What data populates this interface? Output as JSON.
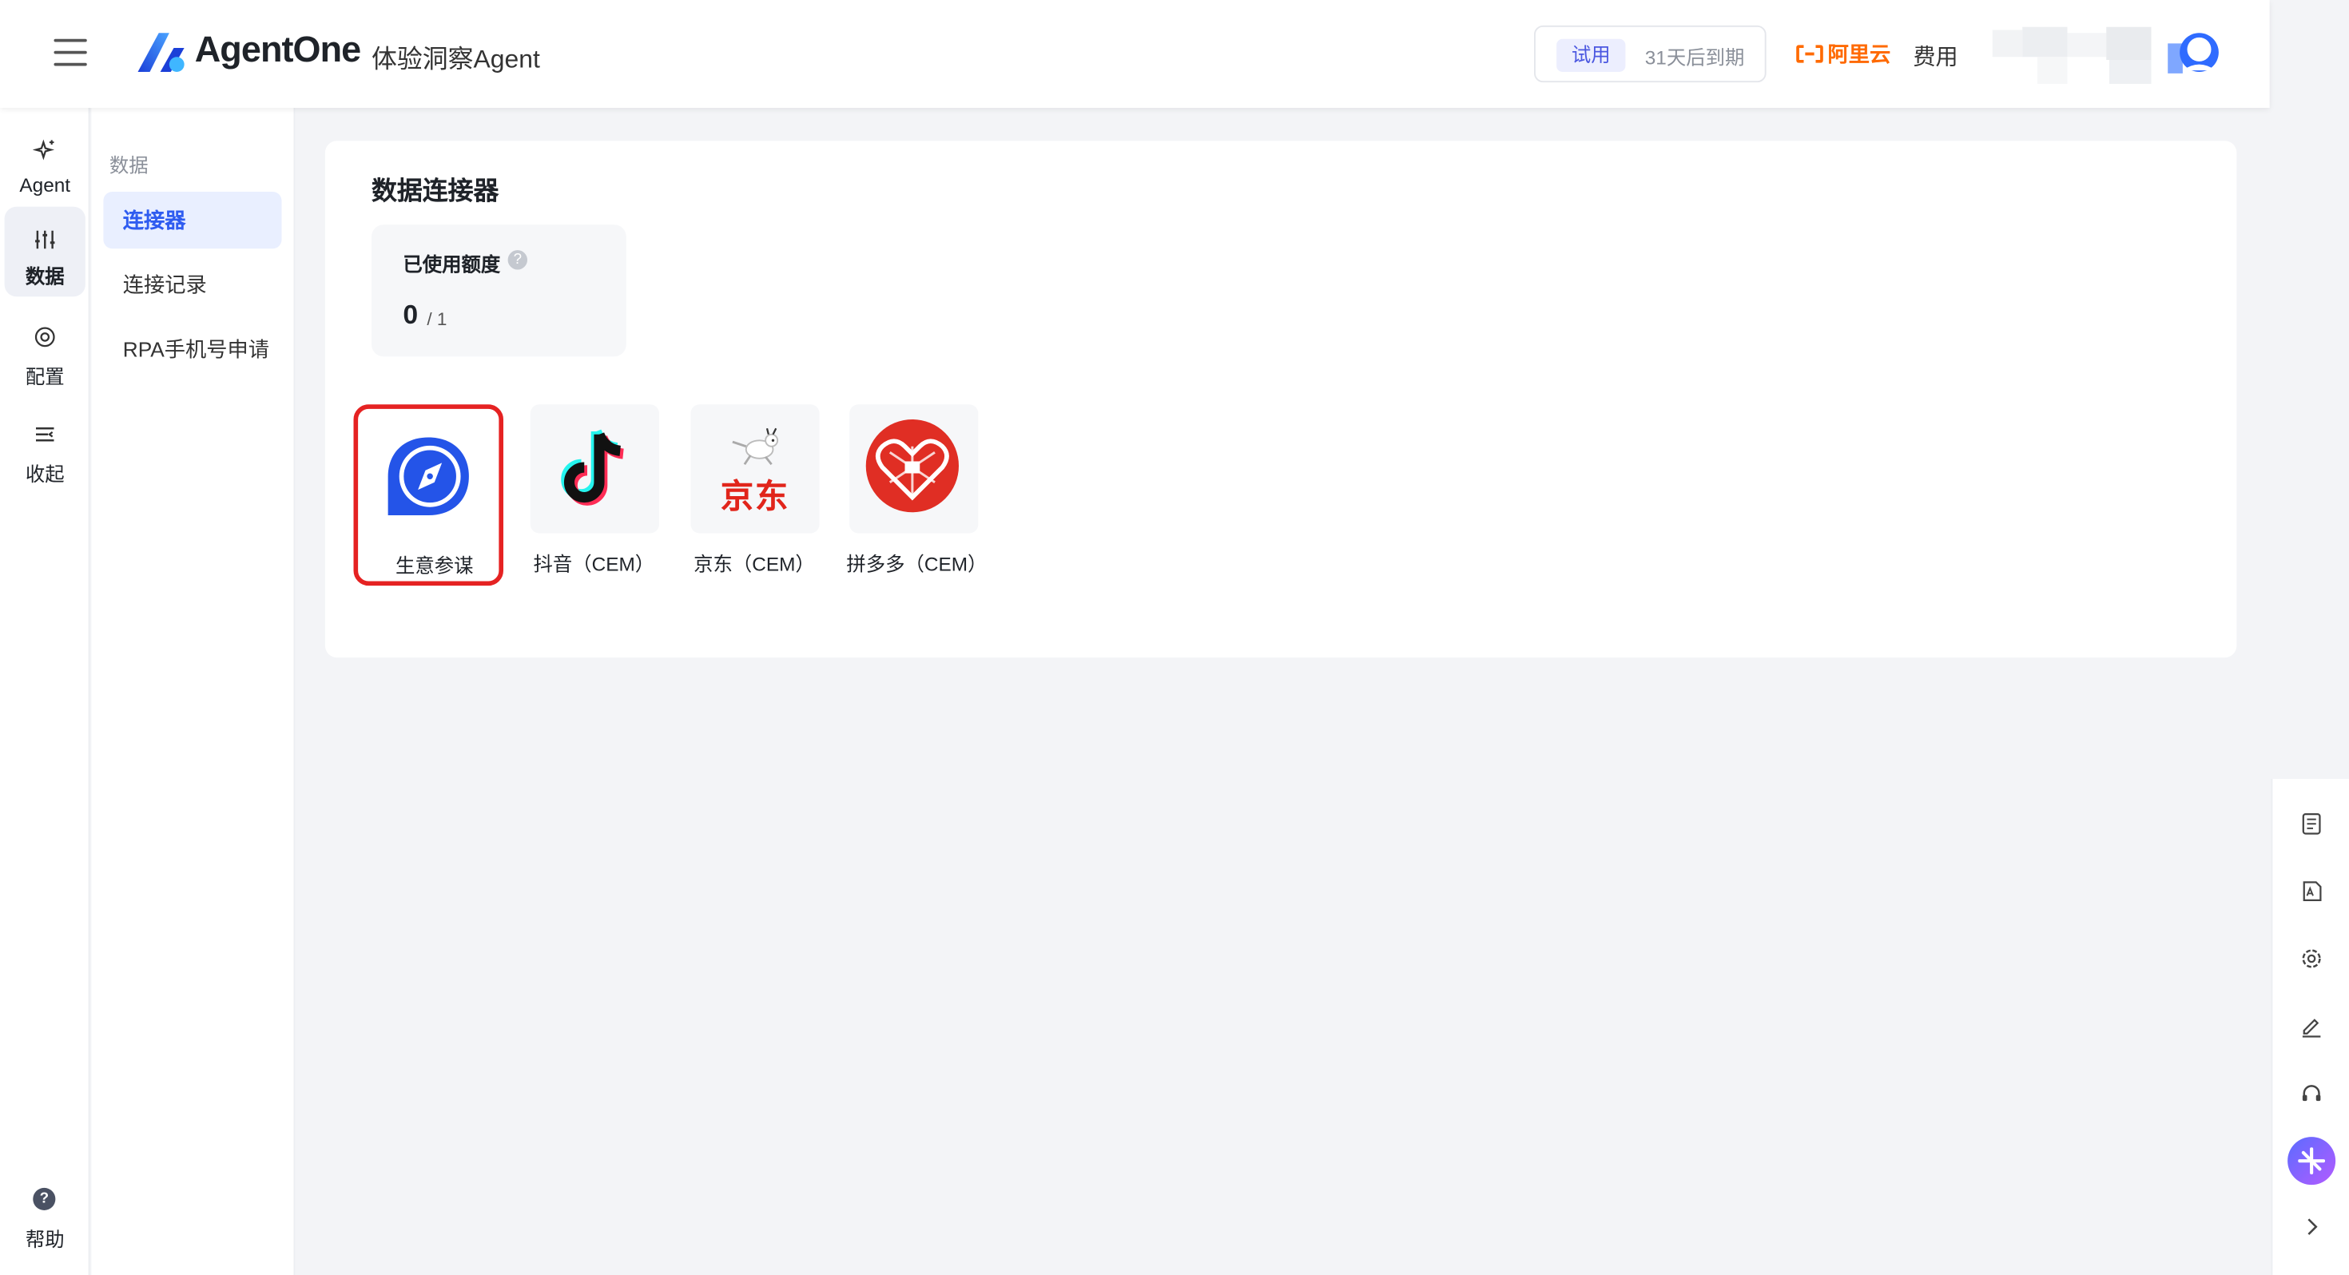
{
  "header": {
    "brand": "AgentOne",
    "subtitle": "体验洞察Agent",
    "trial_tag": "试用",
    "trial_expiry": "31天后到期",
    "aliyun": "阿里云",
    "fee": "费用"
  },
  "rail": {
    "items": [
      {
        "label": "Agent",
        "icon": "sparkle-icon"
      },
      {
        "label": "数据",
        "icon": "sliders-icon",
        "active": true
      },
      {
        "label": "配置",
        "icon": "target-icon"
      },
      {
        "label": "收起",
        "icon": "collapse-icon"
      }
    ],
    "help": "帮助"
  },
  "submenu": {
    "group": "数据",
    "items": [
      {
        "label": "连接器",
        "active": true
      },
      {
        "label": "连接记录"
      },
      {
        "label": "RPA手机号申请"
      }
    ]
  },
  "main": {
    "title": "数据连接器",
    "quota": {
      "label": "已使用额度",
      "help": "?",
      "used": "0",
      "total": "/ 1"
    },
    "connectors": [
      {
        "label": "生意参谋",
        "icon": "compass-icon",
        "selected": true
      },
      {
        "label": "抖音（CEM）",
        "icon": "tiktok-icon"
      },
      {
        "label": "京东（CEM）",
        "icon": "jd-icon",
        "logo_text": "京东"
      },
      {
        "label": "拼多多（CEM）",
        "icon": "pinduoduo-icon"
      }
    ]
  },
  "right_toolbar": [
    "document-icon",
    "api-icon",
    "gear-icon",
    "edit-icon",
    "headset-icon",
    "ai-assistant-icon",
    "chevron-right-icon"
  ],
  "colors": {
    "accent": "#2f5cf0",
    "selected_border": "#e52222",
    "aliyun": "#ff6a00"
  }
}
